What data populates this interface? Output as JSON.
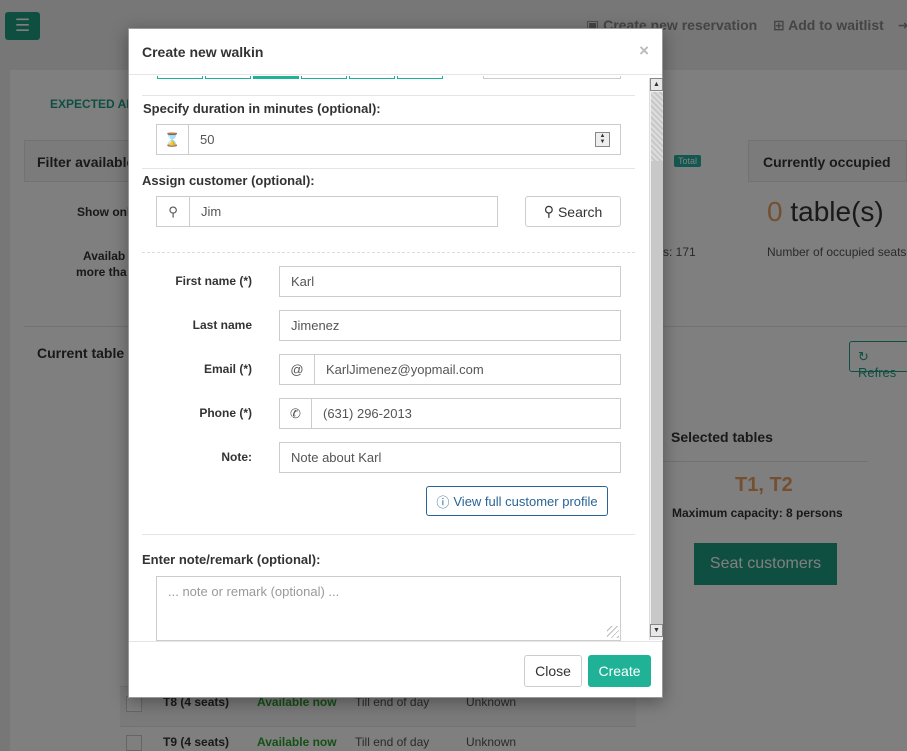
{
  "topbar": {
    "menu_icon": "hamburger-icon",
    "create_reservation": "Create new reservation",
    "add_waitlist": "Add to waitlist"
  },
  "background": {
    "tab_expected": "EXPECTED AR",
    "filter_title": "Filter available",
    "total_badge": "Total",
    "currently_occupied": "Currently occupied",
    "show_only": "Show onl",
    "available_more_1": "Availab",
    "available_more_2": "more tha",
    "occupied_count": "0",
    "occupied_unit": "table(s)",
    "occupied_desc": "Number of occupied seats",
    "s_171": "s: 171",
    "current_tables": "Current table",
    "refresh": "Refres",
    "selected_tables_title": "Selected tables",
    "selected_tables_value": "T1, T2",
    "max_capacity": "Maximum capacity: 8 persons",
    "seat_customers": "Seat customers",
    "rows": [
      {
        "table": "T8 (4 seats)",
        "status": "Available now",
        "until": "Till end of day",
        "who": "Unknown"
      },
      {
        "table": "T9 (4 seats)",
        "status": "Available now",
        "until": "Till end of day",
        "who": "Unknown"
      }
    ]
  },
  "modal": {
    "title": "Create new walkin",
    "close_symbol": "×",
    "duration_label": "Specify duration in minutes (optional):",
    "duration_value": "50",
    "assign_label": "Assign customer (optional):",
    "search_value": "Jim",
    "search_button": "Search",
    "first_name_label": "First name (*)",
    "first_name_value": "Karl",
    "last_name_label": "Last name",
    "last_name_value": "Jimenez",
    "email_label": "Email (*)",
    "email_addon": "@",
    "email_value": "KarlJimenez@yopmail.com",
    "phone_label": "Phone (*)",
    "phone_value": "(631) 296-2013",
    "note_label": "Note:",
    "note_value": "Note about Karl",
    "view_profile": "View full customer profile",
    "remark_label": "Enter note/remark (optional):",
    "remark_placeholder": "... note or remark (optional) ...",
    "close_button": "Close",
    "create_button": "Create"
  },
  "colors": {
    "accent": "#1fb297",
    "brand_dark": "#1f9e84",
    "link": "#2a6496",
    "orange": "#e8a060",
    "green_status": "#2aa12a"
  }
}
